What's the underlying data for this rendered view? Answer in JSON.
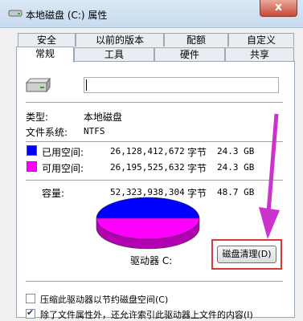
{
  "window": {
    "title": "本地磁盘 (C:) 属性",
    "close_label": "x"
  },
  "tabs": {
    "row1": [
      "安全",
      "以前的版本",
      "配额",
      "自定义"
    ],
    "row2": [
      "常规",
      "工具",
      "硬件",
      "共享"
    ],
    "active": "常规"
  },
  "general": {
    "name_value": "",
    "type_label": "类型:",
    "type_value": "本地磁盘",
    "fs_label": "文件系统:",
    "fs_value": "NTFS",
    "used": {
      "label": "已用空间:",
      "bytes": "26,128,412,672",
      "unit": "字节",
      "size": "24.3 GB",
      "color": "#0000ff"
    },
    "free": {
      "label": "可用空间:",
      "bytes": "26,195,525,632",
      "unit": "字节",
      "size": "24.3 GB",
      "color": "#ff00ff"
    },
    "capacity": {
      "label": "容量:",
      "bytes": "52,323,938,304",
      "unit": "字节",
      "size": "48.7 GB"
    },
    "drive_label": "驱动器 C:",
    "cleanup_button": "磁盘清理(D)",
    "compress_checkbox": "压缩此驱动器以节约磁盘空间(C)",
    "index_checkbox": "除了文件属性外，还允许索引此驱动器上文件的内容(I)"
  },
  "chart_data": {
    "type": "pie",
    "categories": [
      "已用空间",
      "可用空间"
    ],
    "values": [
      24.3,
      24.3
    ],
    "colors": [
      "#0000ff",
      "#ff00ff"
    ]
  },
  "annotation": {
    "arrow_color": "#cc33cc",
    "highlight_color": "#d33a3a"
  }
}
